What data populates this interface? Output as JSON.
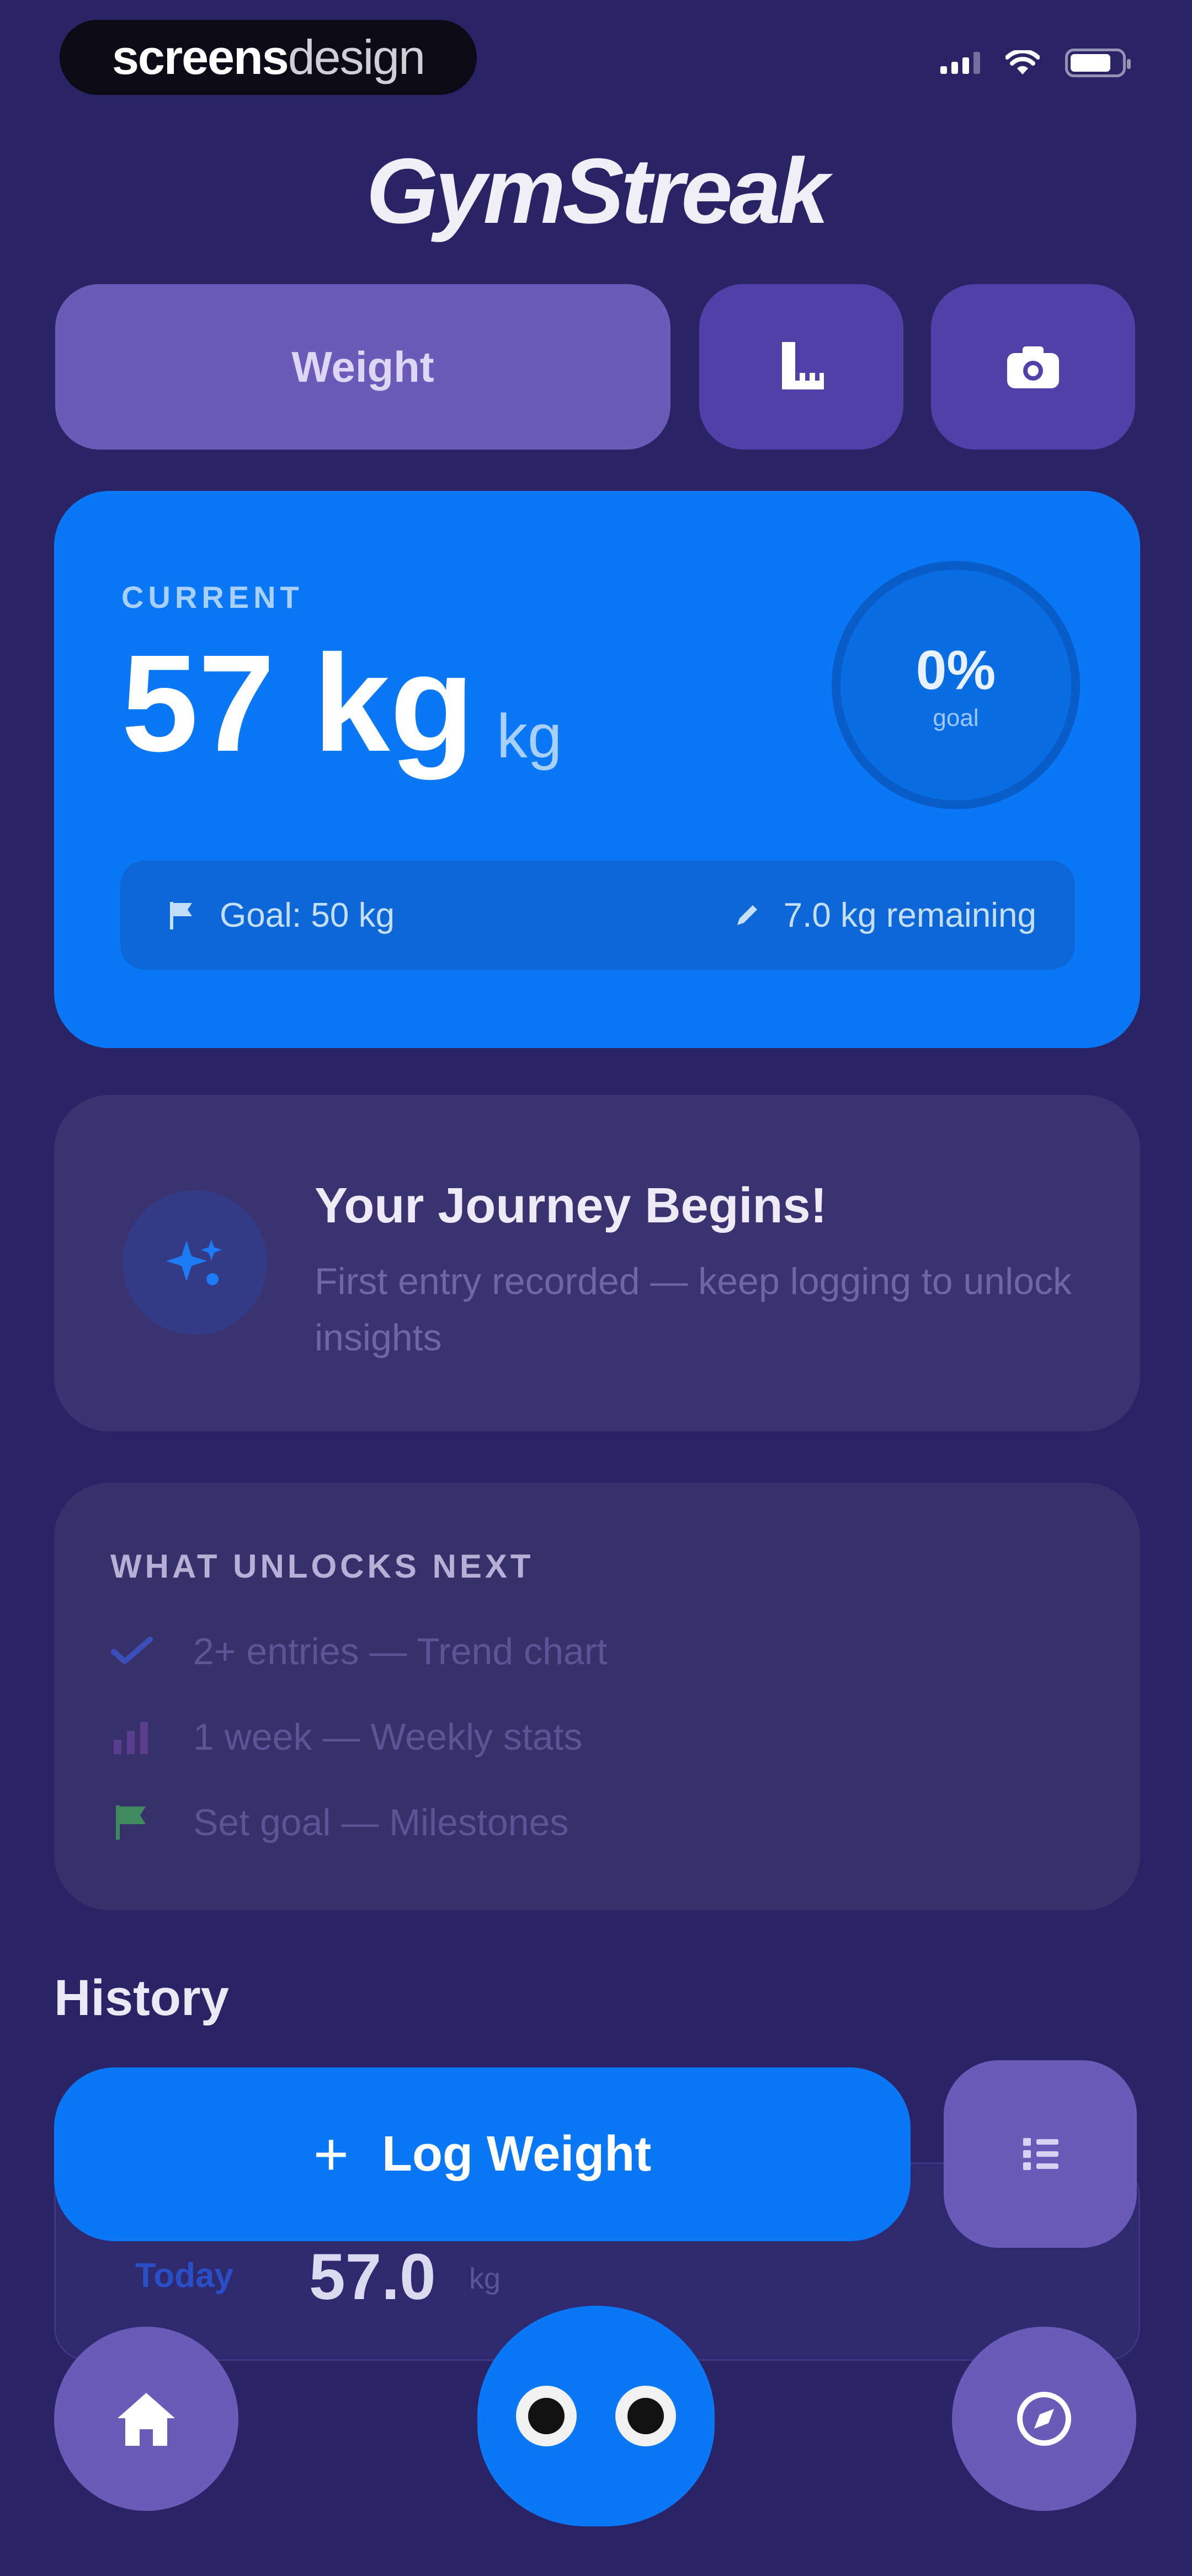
{
  "status_bar": {
    "badge_bold": "screens",
    "badge_light": "design"
  },
  "app": {
    "title": "GymStreak"
  },
  "top_controls": {
    "weight_tab_label": "Weight"
  },
  "current_card": {
    "label": "CURRENT",
    "value": "57 kg",
    "unit": "kg",
    "goal_percent": "0%",
    "goal_percent_label": "goal",
    "goal_text": "Goal: 50 kg",
    "remaining_text": "7.0 kg remaining"
  },
  "journey_card": {
    "title": "Your Journey Begins!",
    "subtitle": "First entry recorded — keep logging to unlock insights"
  },
  "unlocks_card": {
    "title": "WHAT UNLOCKS NEXT",
    "items": [
      {
        "label": "2+ entries — Trend chart",
        "icon": "trend-check-icon",
        "color": "#3a4fb8"
      },
      {
        "label": "1 week — Weekly stats",
        "icon": "bar-chart-icon",
        "color": "#5a3f8f"
      },
      {
        "label": "Set goal — Milestones",
        "icon": "flag-icon",
        "color": "#3f8a5e"
      }
    ]
  },
  "history": {
    "title": "History",
    "entries": [
      {
        "day": "Today",
        "value": "57.0",
        "unit": "kg"
      }
    ]
  },
  "actions": {
    "log_weight_label": "Log Weight"
  },
  "colors": {
    "background": "#2a2466",
    "accent_blue": "#0a78f6",
    "accent_purple": "#6b5bb8"
  }
}
